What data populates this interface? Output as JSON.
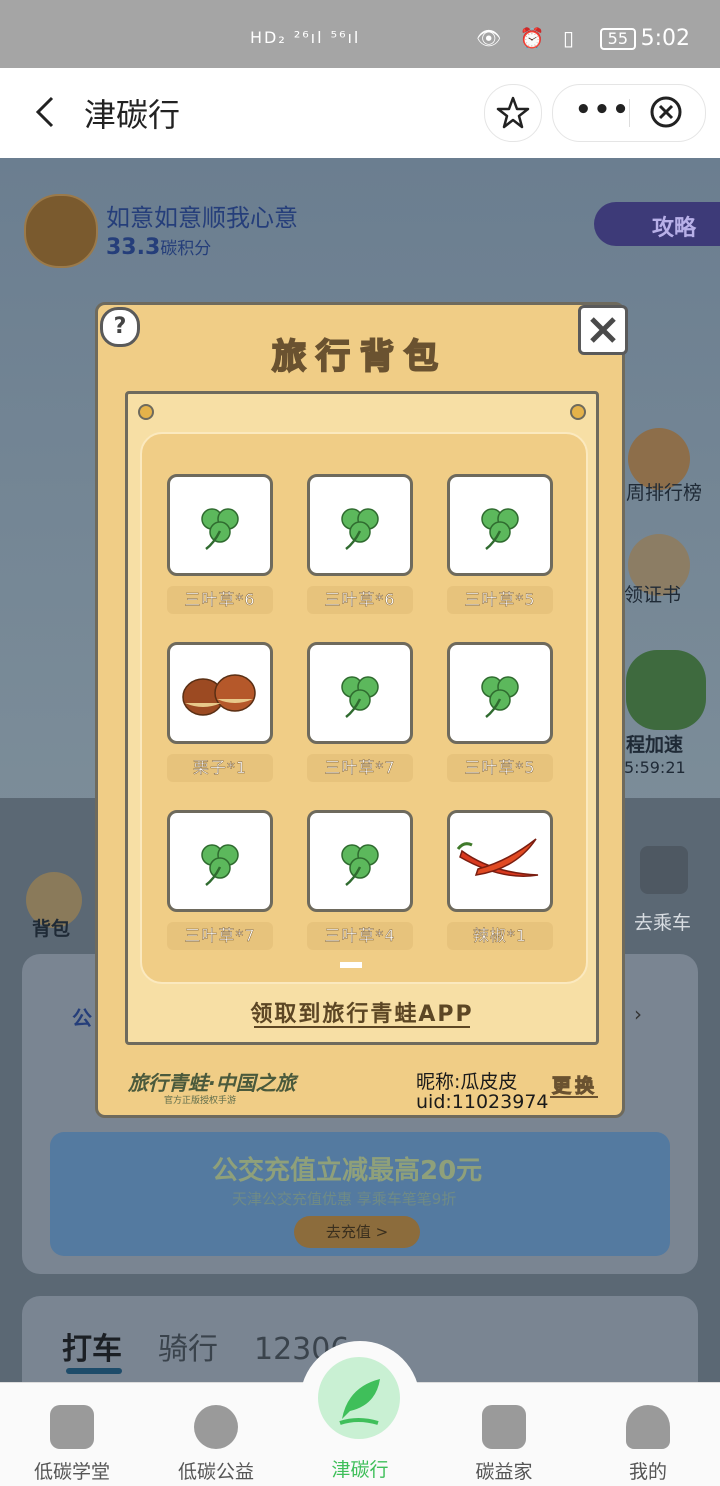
{
  "status_bar": {
    "time": "5:02",
    "battery": "55",
    "net_left": "HD₂ ²⁶ıl ⁵⁶ıl",
    "right_icons": "👁 ⏰ ▯"
  },
  "navbar": {
    "title": "津碳行"
  },
  "profile": {
    "name": "如意如意顺我心意",
    "points": "33.3",
    "points_unit": "碳积分"
  },
  "strategy_label": "攻略",
  "side": {
    "rank": "周排行榜",
    "cert": "领证书",
    "speed": "程加速",
    "timer": "5:59:21",
    "bus": "去乘车",
    "bag": "背包"
  },
  "banner": {
    "title": "公交充值立减最高20元",
    "subtitle": "天津公交充值优惠 享乘车笔笔9折",
    "button": "去充值 >"
  },
  "card_left_char": "公",
  "transport_tabs": [
    "打车",
    "骑行",
    "12306"
  ],
  "modal": {
    "title": "旅行背包",
    "help": "?",
    "items": [
      {
        "label": "三叶草*6",
        "icon": "clover-icon"
      },
      {
        "label": "三叶草*6",
        "icon": "clover-icon"
      },
      {
        "label": "三叶草*5",
        "icon": "clover-icon"
      },
      {
        "label": "栗子*1",
        "icon": "chestnut-icon"
      },
      {
        "label": "三叶草*7",
        "icon": "clover-icon"
      },
      {
        "label": "三叶草*5",
        "icon": "clover-icon"
      },
      {
        "label": "三叶草*7",
        "icon": "clover-icon"
      },
      {
        "label": "三叶草*4",
        "icon": "clover-icon"
      },
      {
        "label": "辣椒*1",
        "icon": "chili-icon"
      }
    ],
    "get_app": "领取到旅行青蛙APP",
    "brand": "旅行青蛙·中国之旅",
    "brand_sub": "官方正版授权手游",
    "nickname": "昵称:瓜皮皮",
    "uid": "uid:11023974",
    "change": "更换"
  },
  "tabbar": [
    {
      "label": "低碳学堂"
    },
    {
      "label": "低碳公益"
    },
    {
      "label": "津碳行",
      "active": true
    },
    {
      "label": "碳益家"
    },
    {
      "label": "我的"
    }
  ],
  "colors": {
    "accent": "#3fbf5a",
    "modal_bg": "#f0cd86",
    "overlay": "#5f6d7c"
  }
}
